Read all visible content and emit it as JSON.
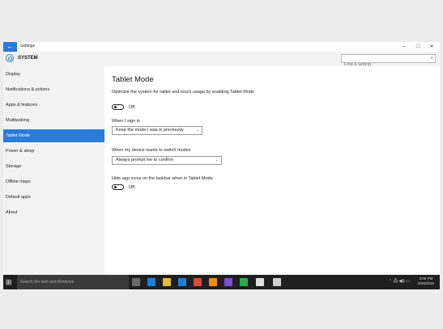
{
  "window": {
    "title": "Settings",
    "back_icon": "back-arrow-icon",
    "minimize": "–",
    "maximize": "□",
    "close": "✕",
    "back_glyph": "←"
  },
  "header": {
    "section": "SYSTEM",
    "search_placeholder": "Find a setting",
    "search_glyph": "⌕"
  },
  "sidebar": {
    "items": [
      {
        "label": "Display"
      },
      {
        "label": "Notifications & actions"
      },
      {
        "label": "Apps & features"
      },
      {
        "label": "Multitasking"
      },
      {
        "label": "Tablet Mode"
      },
      {
        "label": "Power & sleep"
      },
      {
        "label": "Storage"
      },
      {
        "label": "Offline maps"
      },
      {
        "label": "Default apps"
      },
      {
        "label": "About"
      }
    ],
    "active_index": 4
  },
  "main": {
    "title": "Tablet Mode",
    "optimize_label": "Optimize the system for tablet and touch usage by enabling Tablet Mode",
    "optimize_state": "Off",
    "signin_label": "When I sign in",
    "signin_value": "Keep the mode I was in previously",
    "switch_label": "When my device wants to switch modes",
    "switch_value": "Always prompt me to confirm",
    "hide_icons_label": "Hide app icons on the taskbar when in Tablet Mode",
    "hide_icons_state": "Off",
    "chevron": "⌄"
  },
  "taskbar": {
    "search_placeholder": "Search the web and Windows",
    "start_glyph": "⊞",
    "tray_text": "⌃ 🖧 ◀)) ▭",
    "time": "3:06 PM",
    "date": "6/29/2015",
    "app_colors": [
      "#6b6b6b",
      "#1e7fd6",
      "#e7b93b",
      "#1e7fd6",
      "#dc4a38",
      "#f28c1c",
      "#7b4fd0",
      "#2da84a",
      "#e0e0e0",
      "#cfcfcf"
    ]
  }
}
